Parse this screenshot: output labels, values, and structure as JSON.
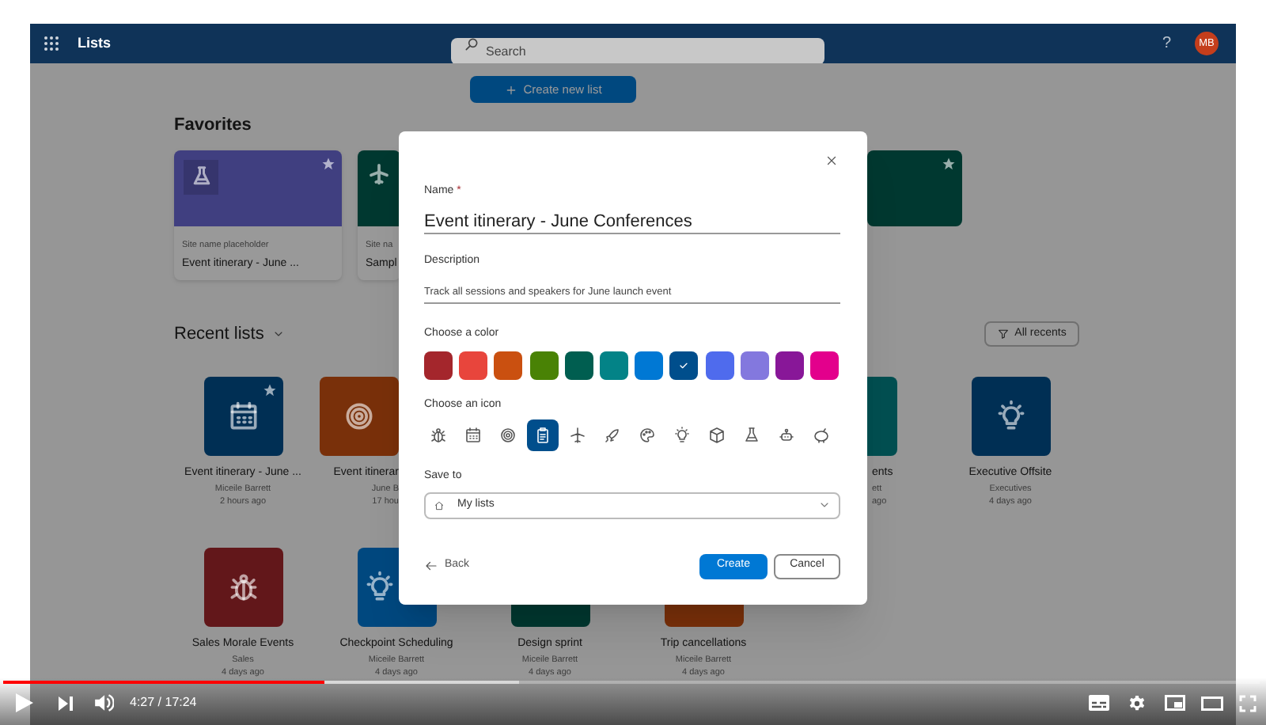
{
  "app": {
    "title": "Lists",
    "search": {
      "placeholder": "Search"
    },
    "help": "?",
    "avatar": "MB",
    "create_button": "Create new list"
  },
  "favorites": {
    "title": "Favorites",
    "cards": [
      {
        "site": "Site name placeholder",
        "title": "Event itinerary - June ...",
        "color": "#403f80",
        "starred": true
      },
      {
        "site": "Site na",
        "title": "Sampl",
        "color": "#003830",
        "starred": false
      },
      {
        "color": "#003830",
        "starred": true
      }
    ]
  },
  "recent": {
    "title": "Recent lists",
    "filter": "All recents",
    "items": [
      {
        "name": "Event itinerary - June ...",
        "owner": "Miceile Barrett",
        "time": "2 hours ago",
        "color": "#002f54",
        "starred": true
      },
      {
        "name": "Event itinerar",
        "owner": "June B",
        "time": "17 hou",
        "color": "#79300a",
        "starred": false
      },
      {
        "name": "ents",
        "owner": "ett",
        "time": "ago",
        "color": "#024f51",
        "starred": false
      },
      {
        "name": "Executive Offsite",
        "owner": "Executives",
        "time": "4 days ago",
        "color": "#002f54",
        "starred": false
      },
      {
        "name": "Sales Morale Events",
        "owner": "Sales",
        "time": "4 days ago",
        "color": "#62171a",
        "starred": false
      },
      {
        "name": "Checkpoint Scheduling",
        "owner": "Miceile Barrett",
        "time": "4 days ago",
        "color": "#00487f",
        "starred": false
      },
      {
        "name": "Design sprint",
        "owner": "Miceile Barrett",
        "time": "4 days ago",
        "color": "#003830",
        "starred": false
      },
      {
        "name": "Trip cancellations",
        "owner": "Miceile Barrett",
        "time": "4 days ago",
        "color": "#79300a",
        "starred": false
      }
    ]
  },
  "dialog": {
    "name_label": "Name",
    "required": "*",
    "name_value": "Event itinerary - June Conferences",
    "description_label": "Description",
    "description_value": "Track all sessions and speakers for June launch event",
    "color_label": "Choose a color",
    "colors": [
      {
        "color": "#a4262c",
        "selected": false
      },
      {
        "color": "#e8453c",
        "selected": false
      },
      {
        "color": "#ca5010",
        "selected": false
      },
      {
        "color": "#498205",
        "selected": false
      },
      {
        "color": "#005e50",
        "selected": false
      },
      {
        "color": "#038387",
        "selected": false
      },
      {
        "color": "#0078d4",
        "selected": false
      },
      {
        "color": "#004e8c",
        "selected": true
      },
      {
        "color": "#4f6bed",
        "selected": false
      },
      {
        "color": "#8378de",
        "selected": false
      },
      {
        "color": "#881798",
        "selected": false
      },
      {
        "color": "#e3008c",
        "selected": false
      }
    ],
    "icon_label": "Choose an icon",
    "icons": [
      {
        "selected": false
      },
      {
        "selected": false
      },
      {
        "selected": false
      },
      {
        "selected": true
      },
      {
        "selected": false
      },
      {
        "selected": false
      },
      {
        "selected": false
      },
      {
        "selected": false
      },
      {
        "selected": false
      },
      {
        "selected": false
      },
      {
        "selected": false
      },
      {
        "selected": false
      }
    ],
    "save_label": "Save to",
    "save_value": "My lists",
    "back": "Back",
    "create": "Create",
    "cancel": "Cancel"
  },
  "player": {
    "progress": {
      "level": 0.256
    },
    "buffer": {
      "level": 0.41
    },
    "time": "4:27 / 17:24"
  }
}
